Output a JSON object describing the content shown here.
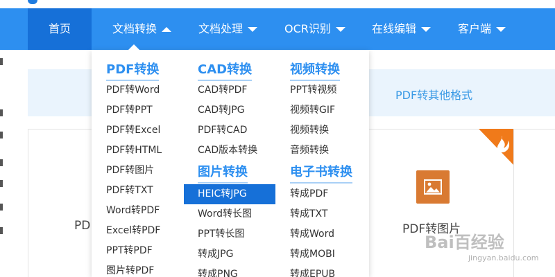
{
  "navbar": {
    "home": "首页",
    "doc_convert": "文档转换",
    "doc_process": "文档处理",
    "ocr": "OCR识别",
    "online_edit": "在线编辑",
    "client": "客户端"
  },
  "banner": {
    "link": "PDF转其他格式"
  },
  "cards": {
    "left_label": "PDF",
    "right_label": "PDF转图片",
    "icon": "image-icon",
    "badge": "hot-fire-icon"
  },
  "dropdown": {
    "col1": {
      "title": "PDF转换",
      "items": [
        "PDF转Word",
        "PDF转PPT",
        "PDF转Excel",
        "PDF转HTML",
        "PDF转图片",
        "PDF转TXT",
        "Word转PDF",
        "Excel转PDF",
        "PPT转PDF",
        "图片转PDF"
      ]
    },
    "col2": {
      "title": "CAD转换",
      "items": [
        "CAD转PDF",
        "CAD转JPG",
        "PDF转CAD",
        "CAD版本转换"
      ],
      "title2": "图片转换",
      "items2": [
        "HEIC转JPG",
        "Word转长图",
        "PPT转长图",
        "转成JPG",
        "转成PNG"
      ]
    },
    "col3": {
      "title": "视频转换",
      "items": [
        "PPT转视频",
        "视频转GIF",
        "视频转换",
        "音频转换"
      ],
      "title2": "电子书转换",
      "items2": [
        "转成PDF",
        "转成TXT",
        "转成Word",
        "转成MOBI",
        "转成EPUB"
      ]
    }
  },
  "watermark": {
    "main": "Bai百经验",
    "sub": "jingyan.baidu.com"
  },
  "colors": {
    "nav_bg": "#2d8ff0",
    "nav_active": "#1670d8",
    "heading": "#2d8ff0",
    "card_icon": "#d97a32",
    "hot_badge": "#f07a1a"
  }
}
